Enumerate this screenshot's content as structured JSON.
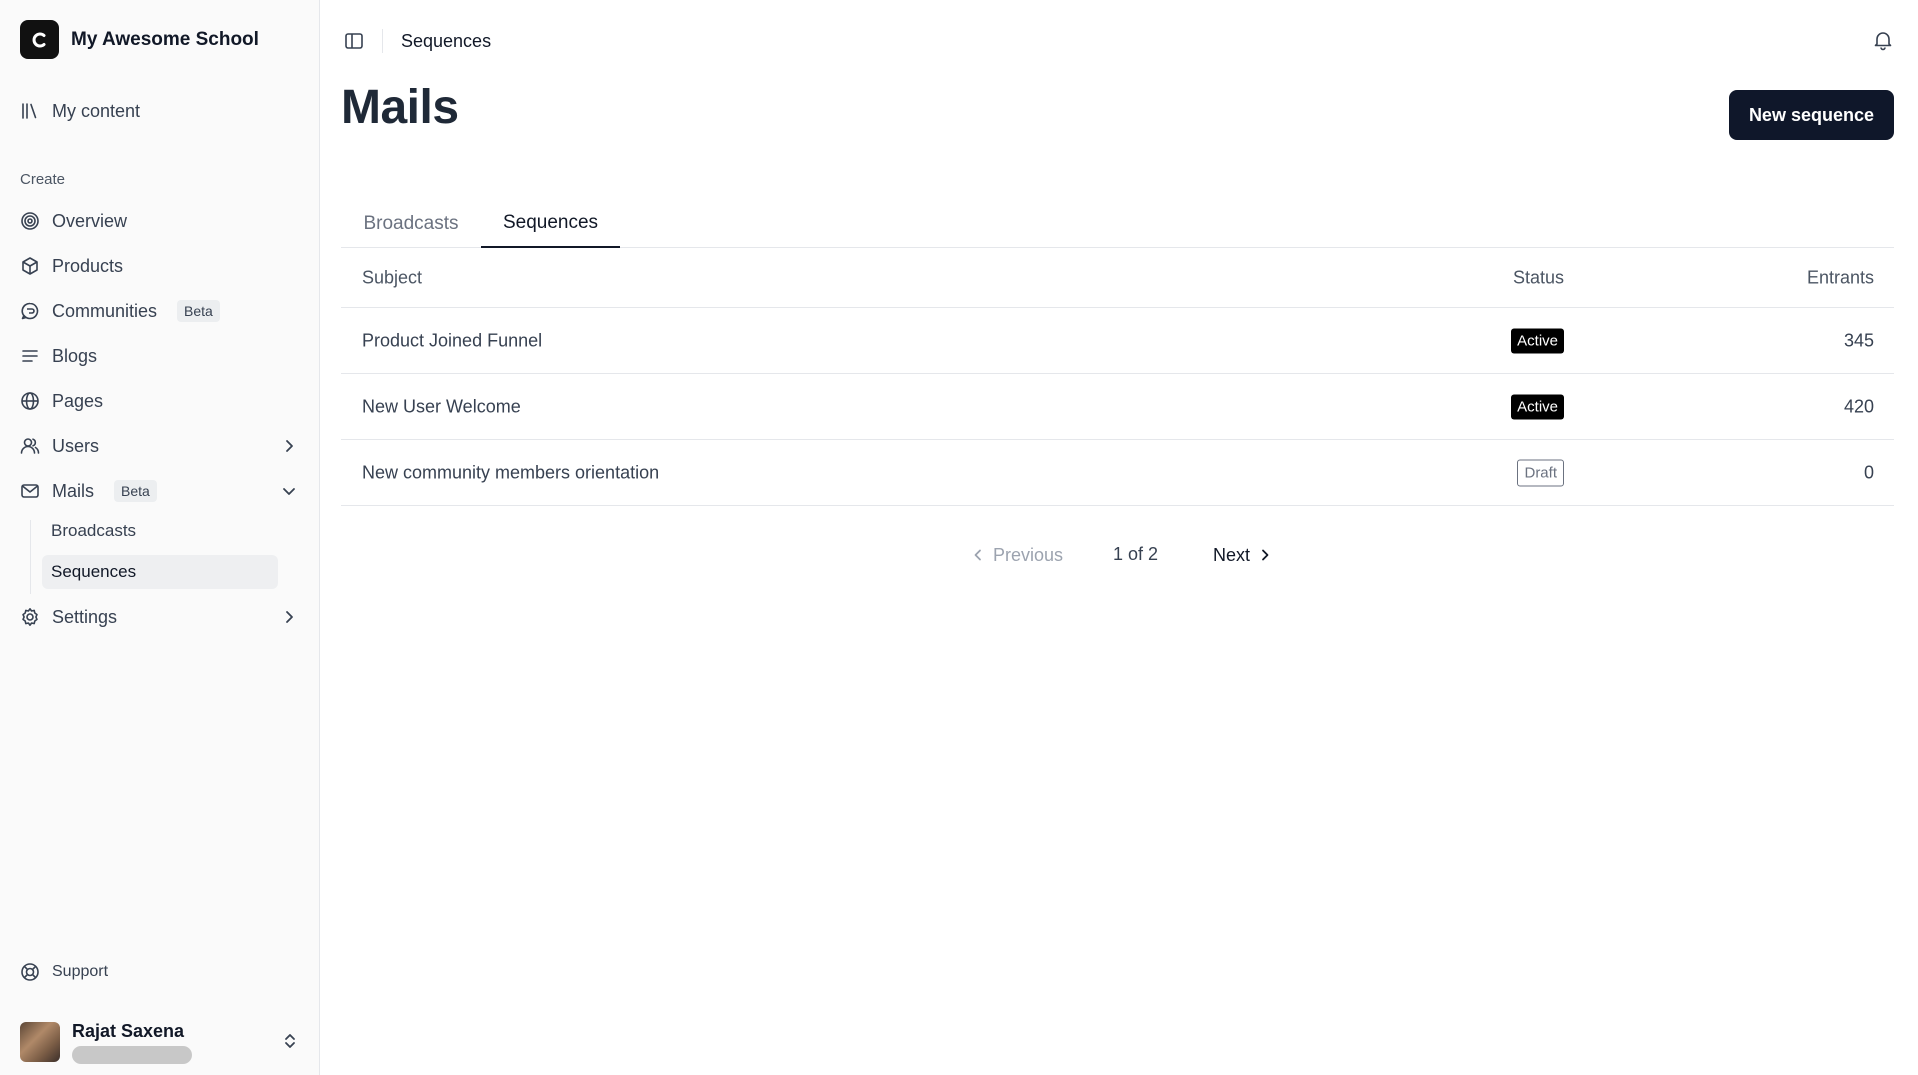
{
  "app": {
    "brand_name": "My Awesome School",
    "brand_letter": "C"
  },
  "sidebar": {
    "my_content": "My content",
    "section_create": "Create",
    "items": {
      "overview": "Overview",
      "products": "Products",
      "communities": "Communities",
      "communities_badge": "Beta",
      "blogs": "Blogs",
      "pages": "Pages",
      "users": "Users",
      "mails": "Mails",
      "mails_badge": "Beta",
      "broadcasts": "Broadcasts",
      "sequences": "Sequences",
      "settings": "Settings"
    },
    "support": "Support",
    "user": {
      "name": "Rajat Saxena"
    }
  },
  "topbar": {
    "breadcrumb": "Sequences"
  },
  "page": {
    "title": "Mails",
    "new_button": "New sequence"
  },
  "tabs": {
    "broadcasts": "Broadcasts",
    "sequences": "Sequences",
    "active": "sequences"
  },
  "table": {
    "headers": {
      "subject": "Subject",
      "status": "Status",
      "entrants": "Entrants"
    },
    "rows": [
      {
        "subject": "Product Joined Funnel",
        "status": "Active",
        "entrants": "345"
      },
      {
        "subject": "New User Welcome",
        "status": "Active",
        "entrants": "420"
      },
      {
        "subject": "New community members orientation",
        "status": "Draft",
        "entrants": "0"
      }
    ]
  },
  "pagination": {
    "previous": "Previous",
    "info": "1 of 2",
    "next": "Next"
  },
  "colors": {
    "primary_button": "#0f172a",
    "active_badge": "#000000",
    "sidebar_bg": "#fafafa"
  }
}
